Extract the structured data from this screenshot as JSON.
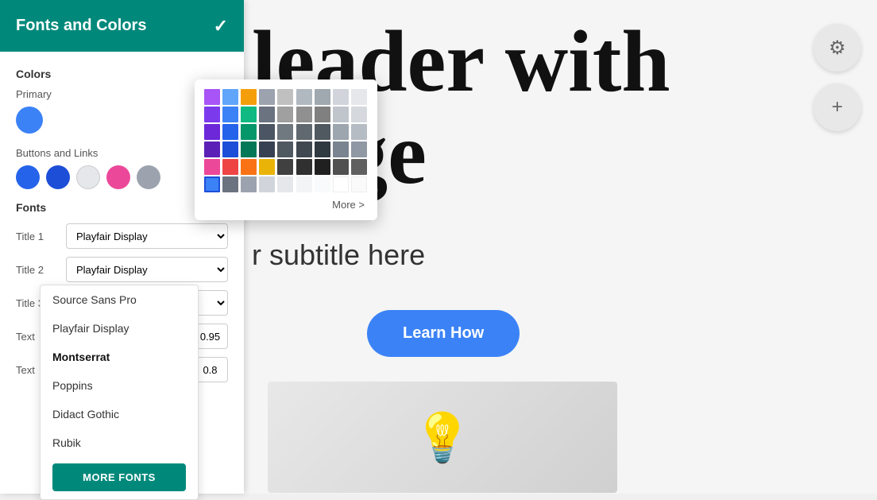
{
  "header": {
    "title": "Fonts and Colors",
    "check_label": "✓",
    "bg_color": "#00897b"
  },
  "colors": {
    "section_label": "Colors",
    "primary_label": "Primary",
    "buttons_links_label": "Buttons and  Links",
    "primary_color": "#3b82f6",
    "color_dots": [
      "#2563eb",
      "#1d4ed8",
      "#e5e7eb",
      "#ec4899",
      "#9ca3af"
    ]
  },
  "fonts": {
    "section_label": "Fonts",
    "rows": [
      {
        "label": "Title 1",
        "value": "Playfair Display",
        "size": null
      },
      {
        "label": "Title 2",
        "value": "Playfair Display",
        "size": null
      },
      {
        "label": "Title 3",
        "value": "Montserrat",
        "size": null
      },
      {
        "label": "Text",
        "value": "Source Sans Pro",
        "size": "0.95"
      },
      {
        "label": "Text",
        "value": "Playfair Display",
        "size": "0.8"
      }
    ]
  },
  "dropdown": {
    "items": [
      "Source Sans Pro",
      "Playfair Display",
      "Montserrat",
      "Poppins",
      "Didact Gothic",
      "Rubik"
    ],
    "selected": "Montserrat"
  },
  "more_fonts_btn": "MORE FONTS",
  "color_picker": {
    "more_label": "More >",
    "colors": [
      "#a855f7",
      "#60a5fa",
      "#f59e0b",
      "#6b7280",
      "#9ca3af",
      "#7c3aed",
      "#3b82f6",
      "#10b981",
      "#6b7280",
      "#4b5563",
      "#8b5cf6",
      "#2563eb",
      "#059669",
      "#374151",
      "#1f2937",
      "#7c3aed",
      "#1d4ed8",
      "#047857",
      "#111827",
      "#030712",
      "#ec4899",
      "#ef4444",
      "#b45309",
      "#6b7280",
      "#9ca3af",
      "#f43f5e",
      "#dc2626",
      "#d97706",
      "#6b7280",
      "#d1d5db",
      "#3b82f6",
      "#6b7280",
      "#9ca3af",
      "#d1d5db",
      "#e5e7eb",
      "#1d4ed8",
      "#4b5563",
      "#9ca3af",
      "#d1d5db",
      "#f3f4f6"
    ]
  },
  "hero": {
    "line1": "leader with",
    "line2": "nage",
    "subtitle": "r subtitle here",
    "cta_label": "Learn How"
  },
  "right_buttons": {
    "settings_icon": "⚙",
    "add_icon": "+"
  }
}
